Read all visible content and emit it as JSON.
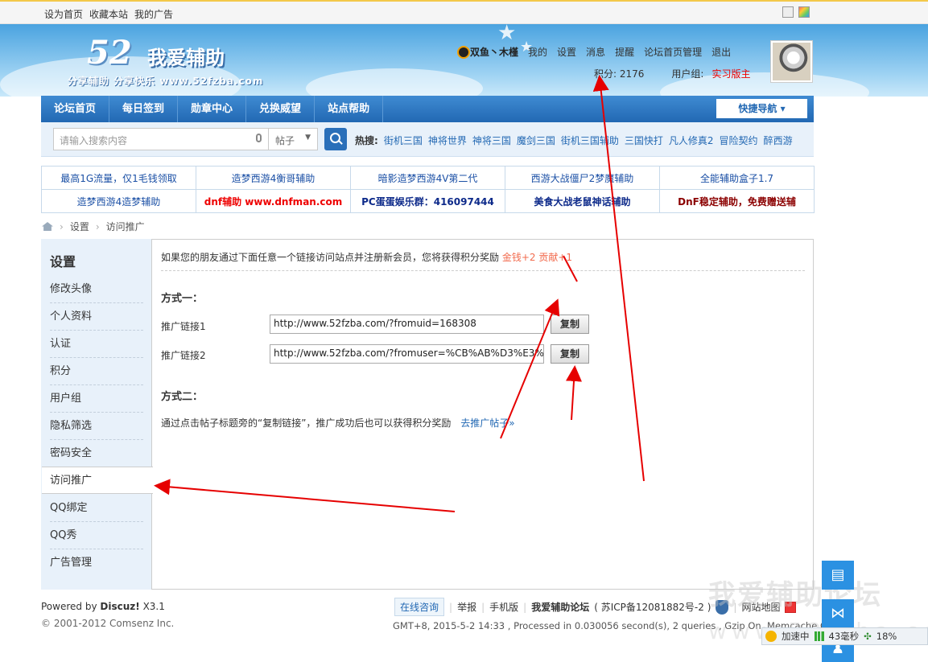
{
  "topbar": {
    "links": [
      "设为首页",
      "收藏本站",
      "我的广告"
    ]
  },
  "logo": {
    "num": "52",
    "name": "我爱辅助",
    "slogan": "分享辅助 分享快乐 www.52fzba.com"
  },
  "user": {
    "name": "双鱼丶木槿",
    "menu": [
      "我的",
      "设置",
      "消息",
      "提醒",
      "论坛首页管理",
      "退出"
    ],
    "points_label": "积分: 2176",
    "group_label": "用户组:",
    "group": "实习版主"
  },
  "nav": {
    "items": [
      "论坛首页",
      "每日签到",
      "勋章中心",
      "兑换威望",
      "站点帮助"
    ],
    "quick": "快捷导航 ▾"
  },
  "search": {
    "placeholder": "请输入搜索内容",
    "type": "帖子",
    "hot_label": "热搜:",
    "hot": [
      "街机三国",
      "神将世界",
      "神将三国",
      "魔剑三国",
      "街机三国辅助",
      "三国快打",
      "凡人修真2",
      "冒险契约",
      "醉西游"
    ]
  },
  "ads": {
    "row1": [
      "最高1G流量，仅1毛钱领取",
      "造梦西游4衡哥辅助",
      "暗影造梦西游4V第二代",
      "西游大战僵尸2梦魔辅助",
      "全能辅助盒子1.7"
    ],
    "row2": [
      "造梦西游4造梦辅助",
      "dnf辅助 www.dnfman.com",
      "PC蛋蛋娱乐群：416097444",
      "美食大战老鼠神话辅助",
      "DnF稳定辅助，免费赠送辅"
    ]
  },
  "crumb": [
    "设置",
    "访问推广"
  ],
  "sidebar": {
    "title": "设置",
    "items": [
      "修改头像",
      "个人资料",
      "认证",
      "积分",
      "用户组",
      "隐私筛选",
      "密码安全",
      "访问推广",
      "QQ绑定",
      "QQ秀",
      "广告管理"
    ]
  },
  "content": {
    "intro": "如果您的朋友通过下面任意一个链接访问站点并注册新会员，您将获得积分奖励",
    "reward": "金钱+2 贡献+1",
    "m1": "方式一：",
    "l1": "推广链接1",
    "v1": "http://www.52fzba.com/?fromuid=168308",
    "l2": "推广链接2",
    "v2": "http://www.52fzba.com/?fromuser=%CB%AB%D3%E3%D",
    "copy": "复制",
    "m2": "方式二：",
    "note": "通过点击帖子标题旁的“复制链接”，推广成功后也可以获得积分奖励",
    "note_link": "去推广帖子»"
  },
  "footer": {
    "powered": "Powered by",
    "discuz": "Discuz!",
    "ver": "X3.1",
    "copy": "© 2001-2012 Comsenz Inc.",
    "online": "在线咨询",
    "report": "举报",
    "mobile": "手机版",
    "site": "我爱辅助论坛",
    "icp": "( 苏ICP备12081882号-2 )",
    "sitemap": "网站地图",
    "gmt": "GMT+8, 2015-5-2 14:33 , Processed in 0.030056 second(s), 2 queries , Gzip On, Memcache On."
  },
  "status": {
    "accel": "加速中",
    "ms": "43毫秒",
    "pct": "18%"
  },
  "watermark": {
    "title": "我爱辅助论坛",
    "url": "www.52fzba.com"
  }
}
